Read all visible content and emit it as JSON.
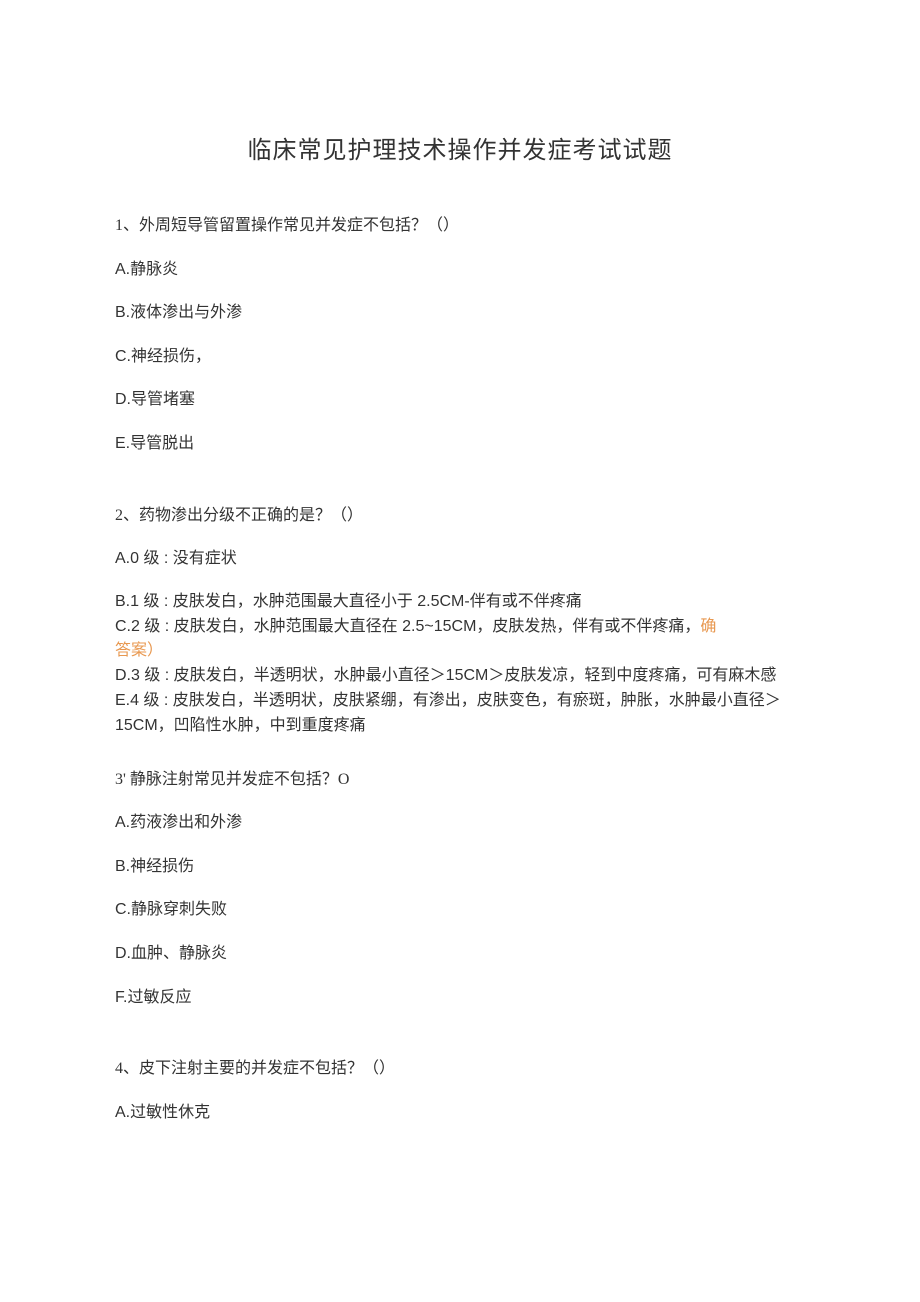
{
  "title": "临床常见护理技术操作并发症考试试题",
  "q1": {
    "stem": "1、外周短导管留置操作常见并发症不包括？（）",
    "a": "A.静脉炎",
    "b": "B.液体渗出与外渗",
    "c": "C.神经损伤，",
    "d": "D.导管堵塞",
    "e": "E.导管脱出"
  },
  "q2": {
    "stem": "2、药物渗出分级不正确的是？（）",
    "a": "A.0 级 : 没有症状",
    "b": "B.1 级 : 皮肤发白，水肿范围最大直径小于 2.5CM-伴有或不伴疼痛",
    "c_pre": "C.2 级 : 皮肤发白，水肿范围最大直径在 2.5~15CM，皮肤发热，伴有或不伴疼痛，",
    "c_ans1": "确",
    "c_ans2": "答案）",
    "d": "D.3 级 : 皮肤发白，半透明状，水肿最小直径＞15CM＞皮肤发凉，轻到中度疼痛，可有麻木感",
    "e": "E.4 级 : 皮肤发白，半透明状，皮肤紧绷，有渗出，皮肤变色，有瘀斑，肿胀，水肿最小直径＞15CM，凹陷性水肿，中到重度疼痛"
  },
  "q3": {
    "stem": "3' 静脉注射常见并发症不包括？O",
    "a": "A.药液渗出和外渗",
    "b": "B.神经损伤",
    "c": "C.静脉穿刺失败",
    "d": "D.血肿、静脉炎",
    "f": "F.过敏反应"
  },
  "q4": {
    "stem": "4、皮下注射主要的并发症不包括？（）",
    "a": "A.过敏性休克"
  }
}
